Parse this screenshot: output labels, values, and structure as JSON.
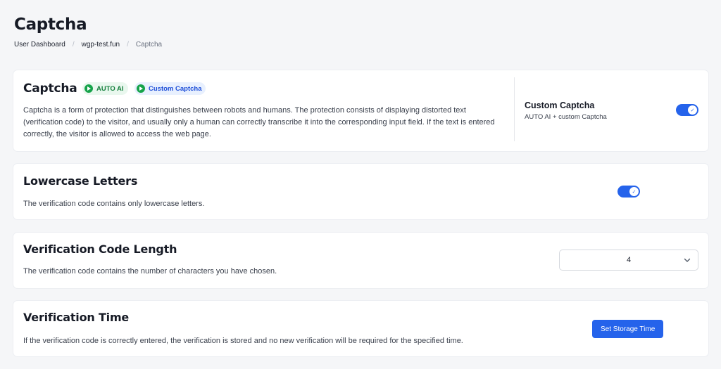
{
  "page": {
    "title": "Captcha",
    "breadcrumb": [
      "User Dashboard",
      "wgp-test.fun",
      "Captcha"
    ]
  },
  "captcha": {
    "title": "Captcha",
    "badges": [
      "AUTO AI",
      "Custom Captcha"
    ],
    "description": "Captcha is a form of protection that distinguishes between robots and humans. The protection consists of displaying distorted text (verification code) to the visitor, and usually only a human can correctly transcribe it into the corresponding input field. If the text is entered correctly, the visitor is allowed to access the web page.",
    "option_title": "Custom Captcha",
    "option_subtitle": "AUTO AI + custom Captcha",
    "toggle_on": true
  },
  "lowercase": {
    "title": "Lowercase Letters",
    "description": "The verification code contains only lowercase letters.",
    "toggle_on": true
  },
  "length": {
    "title": "Verification Code Length",
    "description": "The verification code contains the number of characters you have chosen.",
    "selected": "4"
  },
  "time": {
    "title": "Verification Time",
    "description": "If the verification code is correctly entered, the verification is stored and no new verification will be required for the specified time.",
    "button": "Set Storage Time"
  },
  "colors": {
    "accent": "#2563eb",
    "badge_green": "#15803d",
    "badge_blue": "#1d4ed8"
  },
  "icons": {
    "badge": "play-icon",
    "toggle": "check-icon",
    "select": "chevron-down-icon"
  }
}
